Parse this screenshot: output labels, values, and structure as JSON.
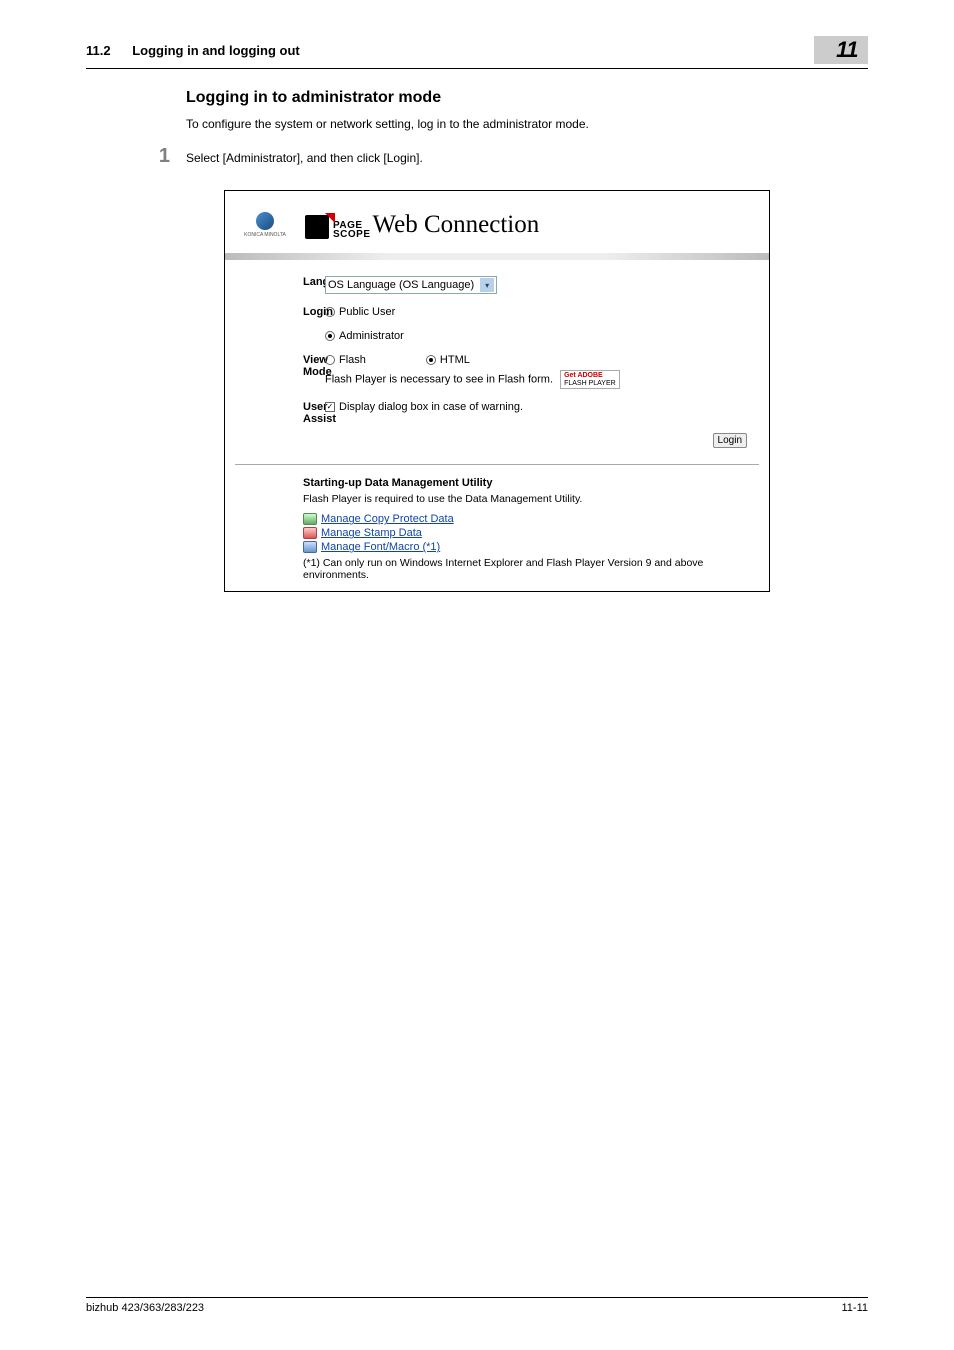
{
  "header": {
    "section_number": "11.2",
    "section_title": "Logging in and logging out",
    "chapter_number": "11"
  },
  "main": {
    "heading": "Logging in to administrator mode",
    "intro": "To configure the system or network setting, log in to the administrator mode.",
    "step_number": "1",
    "step_text": "Select [Administrator], and then click [Login]."
  },
  "screenshot": {
    "brand_small": "KONICA MINOLTA",
    "ps_line1": "PAGE",
    "ps_line2": "SCOPE",
    "title_large": "Web Connection",
    "rows": {
      "language_label": "Language",
      "language_value": "OS Language (OS Language)",
      "login_label": "Login",
      "login_opt1": "Public User",
      "login_opt2": "Administrator",
      "viewmode_label": "View Mode",
      "viewmode_opt1": "Flash",
      "viewmode_opt2": "HTML",
      "viewmode_note": "Flash Player is necessary to see in Flash form.",
      "flash_btn_l1": "Get ADOBE",
      "flash_btn_l2": "FLASH PLAYER",
      "userassist_label": "User Assist",
      "userassist_opt": "Display dialog box in case of warning."
    },
    "login_button": "Login",
    "footer": {
      "title": "Starting-up Data Management Utility",
      "note": "Flash Player is required to use the Data Management Utility.",
      "link1": "Manage Copy Protect Data",
      "link2": "Manage Stamp Data",
      "link3": "Manage Font/Macro (*1)",
      "footnote": "(*1) Can only run on Windows Internet Explorer and Flash Player Version 9 and above environments."
    }
  },
  "footer": {
    "left": "bizhub 423/363/283/223",
    "right": "11-11"
  }
}
